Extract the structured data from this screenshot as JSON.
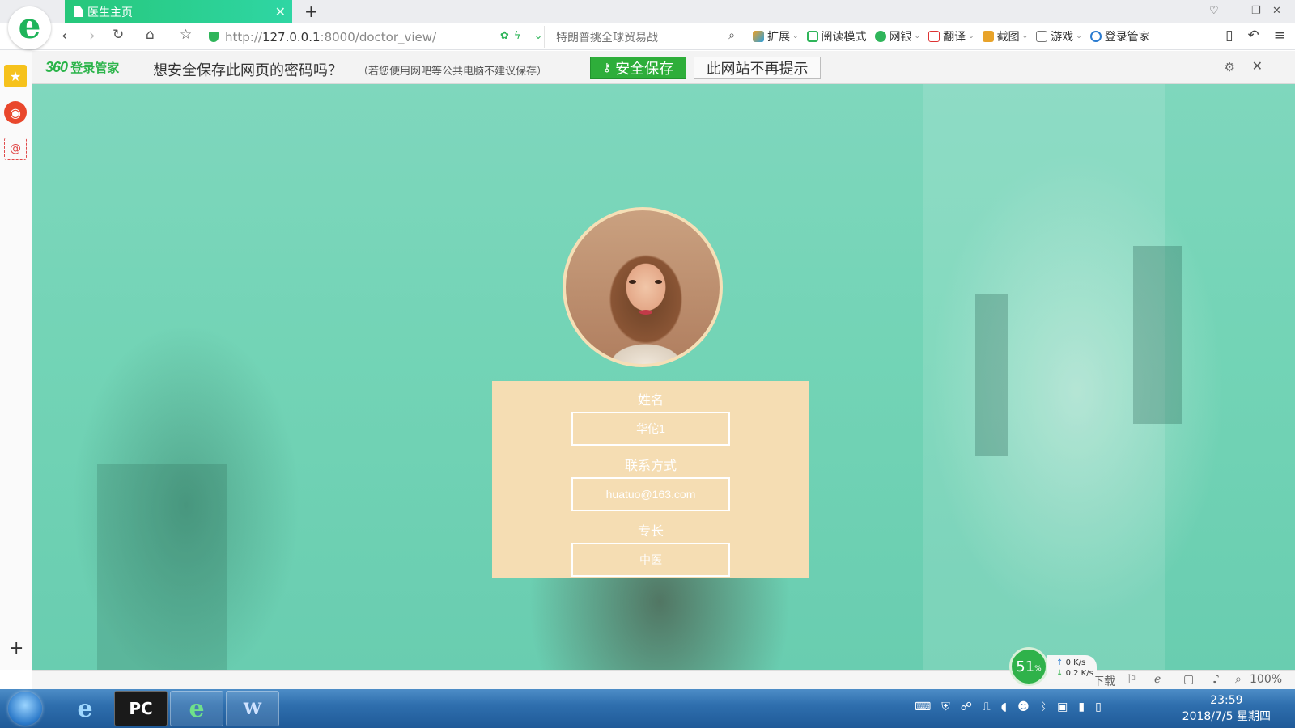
{
  "browser": {
    "tab_title": "医生主页",
    "url_prefix": "http://",
    "url_host": "127.0.0.1",
    "url_rest": ":8000/doctor_view/",
    "search_placeholder": "特朗普挑全球贸易战",
    "toolbar": [
      "扩展",
      "阅读模式",
      "网银",
      "翻译",
      "截图",
      "游戏",
      "登录管家"
    ]
  },
  "password_bar": {
    "brand_num": "360",
    "brand_text": "登录管家",
    "message": "想安全保存此网页的密码吗？",
    "hint": "（若您使用网吧等公共电脑不建议保存）",
    "save_label": "安全保存",
    "never_label": "此网站不再提示"
  },
  "profile": {
    "name_label": "姓名",
    "name_value": "华佗1",
    "contact_label": "联系方式",
    "contact_value": "huatuo@163.com",
    "specialty_label": "专长",
    "specialty_value": "中医"
  },
  "status": {
    "net_percent": "51",
    "net_unit": "%",
    "upload_rate": "0 K/s",
    "download_rate": "0.2 K/s",
    "download_label": "下载",
    "zoom": "100%"
  },
  "taskbar": {
    "time": "23:59",
    "date": "2018/7/5 星期四"
  }
}
